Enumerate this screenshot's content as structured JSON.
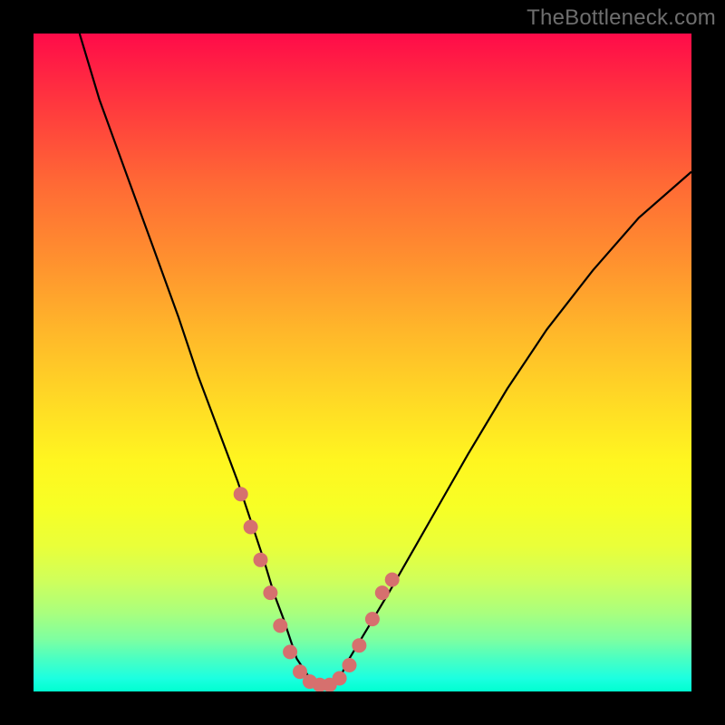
{
  "watermark": "TheBottleneck.com",
  "colors": {
    "page_bg": "#000000",
    "curve_stroke": "#000000",
    "marker_fill": "#d6706e",
    "gradient_top": "#ff0b49",
    "gradient_bottom": "#00ffd0"
  },
  "chart_data": {
    "type": "line",
    "title": "",
    "xlabel": "",
    "ylabel": "",
    "xlim": [
      0,
      100
    ],
    "ylim": [
      0,
      100
    ],
    "grid": false,
    "series": [
      {
        "name": "bottleneck-curve",
        "x": [
          7,
          10,
          14,
          18,
          22,
          25,
          28,
          31,
          33,
          35,
          36.5,
          38,
          39,
          40,
          42,
          44,
          45,
          46.5,
          48,
          51,
          54,
          58,
          62,
          66,
          72,
          78,
          85,
          92,
          100
        ],
        "values": [
          100,
          90,
          79,
          68,
          57,
          48,
          40,
          32,
          26,
          20,
          15,
          11,
          8,
          5,
          2,
          1,
          1,
          2,
          5,
          10,
          15,
          22,
          29,
          36,
          46,
          55,
          64,
          72,
          79
        ]
      }
    ],
    "markers": {
      "name": "highlight-points",
      "x": [
        31.5,
        33,
        34.5,
        36,
        37.5,
        39,
        40.5,
        42,
        43.5,
        45,
        46.5,
        48,
        49.5,
        51.5,
        53,
        54.5
      ],
      "values": [
        30,
        25,
        20,
        15,
        10,
        6,
        3,
        1.5,
        1,
        1,
        2,
        4,
        7,
        11,
        15,
        17
      ]
    }
  }
}
